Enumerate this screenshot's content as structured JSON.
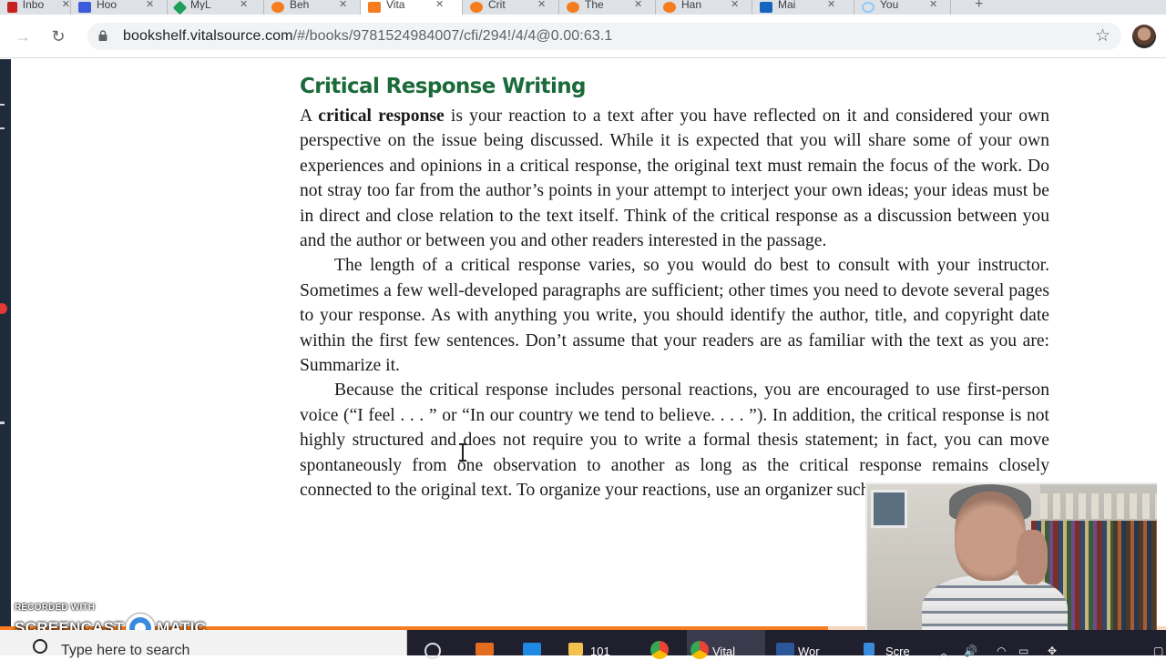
{
  "browser": {
    "tabs": [
      {
        "label": "Inbo",
        "icon_color": "#c5221f",
        "active": false
      },
      {
        "label": "Hoo",
        "icon_color": "#3b5bdb",
        "active": false
      },
      {
        "label": "MyL",
        "icon_color": "#1e9e5a",
        "active": false
      },
      {
        "label": "Beh",
        "icon_color": "#f57c1f",
        "active": false
      },
      {
        "label": "Vita",
        "icon_color": "#f57c1f",
        "active": true
      },
      {
        "label": "Crit",
        "icon_color": "#f57c1f",
        "active": false
      },
      {
        "label": "The",
        "icon_color": "#f57c1f",
        "active": false
      },
      {
        "label": "Han",
        "icon_color": "#f57c1f",
        "active": false
      },
      {
        "label": "Mai",
        "icon_color": "#1565c0",
        "active": false
      },
      {
        "label": "You",
        "icon_color": "#90caf9",
        "active": false
      }
    ],
    "tab_close_glyph": "✕",
    "new_tab_glyph": "+",
    "url_host": "bookshelf.vitalsource.com",
    "url_rest": "/#/books/9781524984007/cfi/294!/4/4@0.00:63.1",
    "reading_progress_percent": 71
  },
  "book": {
    "heading": "Critical Response Writing",
    "p1_lead": "A ",
    "p1_term": "critical response",
    "p1_rest": " is your reaction to a text after you have reflected on it and considered your own perspective on the issue being discussed. While it is expected that you will share some of your own experiences and opinions in a critical response, the original text must remain the focus of the work. Do not stray too far from the author’s points in your attempt to interject your own ideas; your ideas must be in direct and close relation to the text itself. Think of the critical response as a discussion between you and the author or between you and other readers interested in the passage.",
    "p2": "The length of a critical response varies, so you would do best to consult with your instructor. Sometimes a few well-developed paragraphs are sufficient; other times you need to devote several pages to your response. As with anything you write, you should identify the author, title, and copyright date within the first few sentences. Don’t assume that your readers are as familiar with the text as you are: Summarize it.",
    "p3": "Because the critical response includes personal reactions, you are encouraged to use first-person voice (“I feel . . . ” or “In our country we tend to believe. . . . ”). In addition, the critical response is not highly structured and does not require you to write a formal thesis statement; in fact, you can move spontaneously from one observation to another as long as the critical response remains closely connected to the original text. To organize your reactions, use an organizer such as this Planning Form."
  },
  "taskbar": {
    "search_placeholder": "Type here to search",
    "items": [
      {
        "label": "",
        "color": "#e36c1e"
      },
      {
        "label": "",
        "color": "#1e88e5"
      },
      {
        "label": "101",
        "color": "#f2c14e"
      },
      {
        "label": "",
        "color": "#34a853"
      },
      {
        "label": "Vital",
        "color": "#ea4335"
      },
      {
        "label": "Wor",
        "color": "#2b579a"
      },
      {
        "label": "Scre",
        "color": "#3a8be0"
      }
    ]
  },
  "watermark": {
    "line1": "RECORDED WITH",
    "word_left": "SCREENCAST",
    "word_right": "MATIC"
  }
}
